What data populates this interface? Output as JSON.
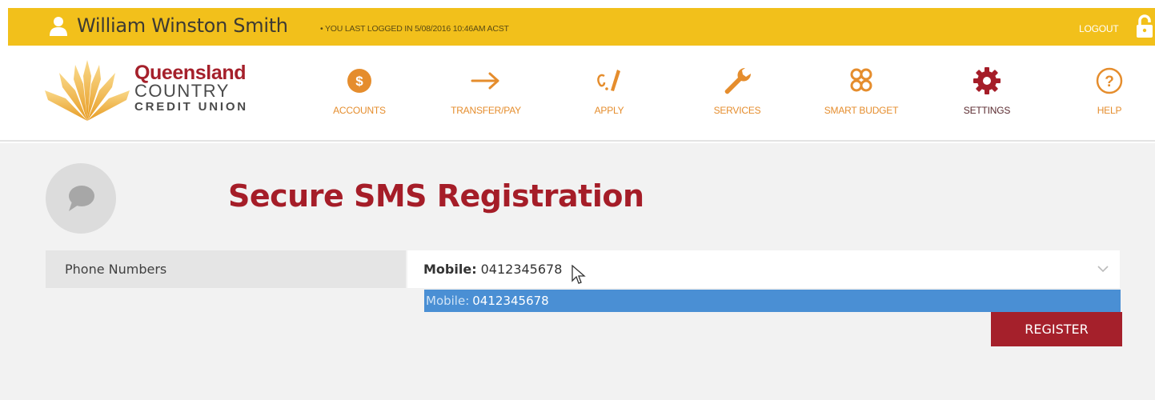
{
  "topbar": {
    "user_name": "William Winston Smith",
    "last_login": "• YOU LAST LOGGED IN 5/08/2016 10:46AM ACST",
    "logout_label": "LOGOUT"
  },
  "brand": {
    "line1": "Queensland",
    "line2": "COUNTRY",
    "line3": "CREDIT UNION"
  },
  "nav": {
    "items": [
      {
        "label": "ACCOUNTS",
        "icon": "dollar-coin-icon"
      },
      {
        "label": "TRANSFER/PAY",
        "icon": "arrow-right-icon"
      },
      {
        "label": "APPLY",
        "icon": "pen-icon"
      },
      {
        "label": "SERVICES",
        "icon": "wrench-icon"
      },
      {
        "label": "SMART BUDGET",
        "icon": "budget-knot-icon"
      },
      {
        "label": "SETTINGS",
        "icon": "gear-icon",
        "active": true
      },
      {
        "label": "HELP",
        "icon": "question-icon"
      }
    ]
  },
  "page": {
    "title": "Secure SMS Registration"
  },
  "form": {
    "phone_label": "Phone Numbers",
    "selected_prefix": "Mobile:",
    "selected_value": "0412345678",
    "options": [
      {
        "prefix": "Mobile:",
        "value": "0412345678"
      }
    ],
    "register_label": "REGISTER"
  },
  "colors": {
    "topbar": "#f2c01b",
    "brand_red": "#a5202b",
    "nav_orange": "#e58d2d",
    "highlight": "#4a8fd4"
  }
}
